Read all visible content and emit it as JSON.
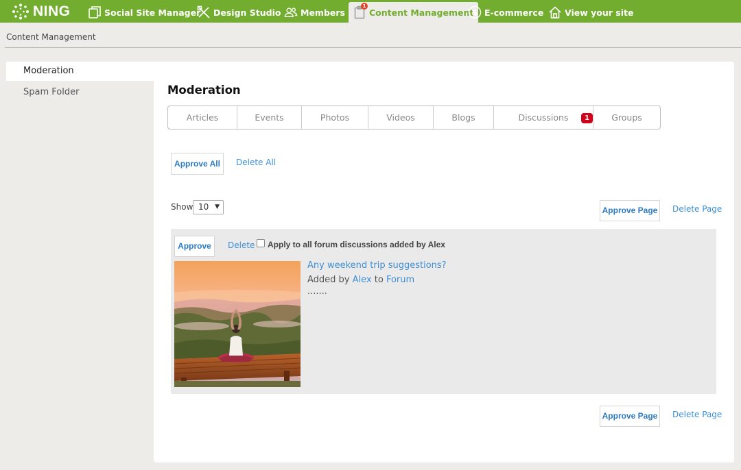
{
  "nav": {
    "logo": "NING",
    "items": [
      {
        "label": "Social Site Manager",
        "icon": "copy-icon"
      },
      {
        "label": "Design Studio",
        "icon": "design-tools-icon"
      },
      {
        "label": "Members",
        "icon": "members-icon"
      },
      {
        "label": "Content Management",
        "icon": "clipboard-icon",
        "active": true,
        "badge": "1"
      },
      {
        "label": "E-commerce",
        "icon": "dollar-icon"
      },
      {
        "label": "View your site",
        "icon": "home-icon"
      }
    ]
  },
  "breadcrumb": "Content Management",
  "sidebar": {
    "items": [
      {
        "label": "Moderation",
        "active": true
      },
      {
        "label": "Spam Folder",
        "active": false
      }
    ]
  },
  "main": {
    "title": "Moderation",
    "tabs": [
      {
        "label": "Articles"
      },
      {
        "label": "Events"
      },
      {
        "label": "Photos"
      },
      {
        "label": "Videos"
      },
      {
        "label": "Blogs"
      },
      {
        "label": "Discussions",
        "badge": "1"
      },
      {
        "label": "Groups"
      }
    ],
    "approve_all": "Approve All",
    "delete_all": "Delete All",
    "show_label": "Show",
    "show_value": "10",
    "approve_page": "Approve Page",
    "delete_page": "Delete Page",
    "item": {
      "approve": "Approve",
      "delete": "Delete",
      "apply_label": "Apply to all forum discussions added by Alex",
      "title": "Any weekend trip suggestions?",
      "added_by_prefix": "Added by",
      "author": "Alex",
      "to_word": "to",
      "location": "Forum",
      "excerpt": "......."
    }
  },
  "colors": {
    "brand_green": "#73ad2f",
    "link_blue": "#3d8fd6",
    "badge_red": "#d0021b"
  }
}
